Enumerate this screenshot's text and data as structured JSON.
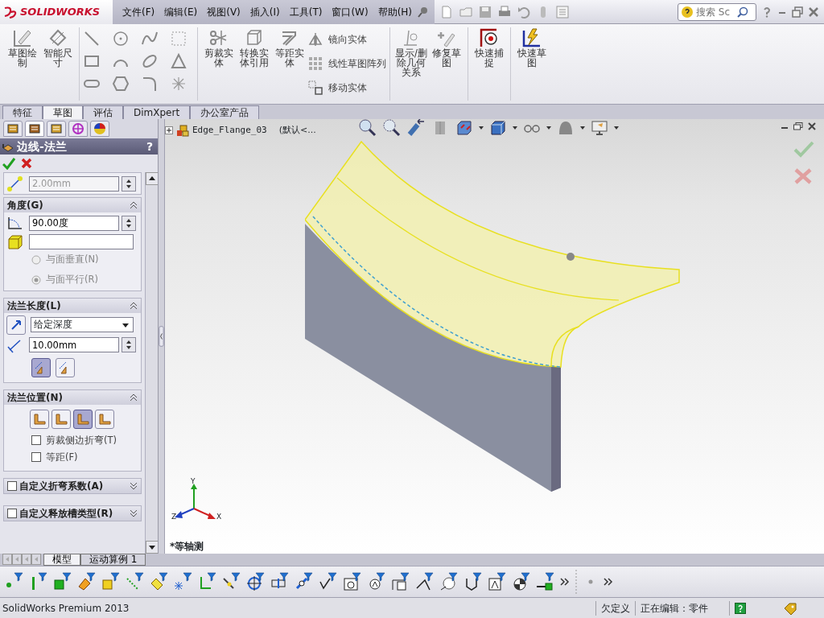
{
  "app": {
    "logo": "SOLIDWORKS"
  },
  "menu": [
    "文件(F)",
    "编辑(E)",
    "视图(V)",
    "插入(I)",
    "工具(T)",
    "窗口(W)",
    "帮助(H)"
  ],
  "search": {
    "placeholder": "搜索 Sc"
  },
  "ribbon": {
    "sketch_buttons": [
      "草图绘制",
      "智能尺寸"
    ],
    "edit_buttons": [
      "剪裁实体",
      "转换实体引用",
      "等距实体"
    ],
    "small_buttons": [
      "镜向实体",
      "线性草图阵列",
      "移动实体"
    ],
    "relation_buttons": [
      "显示/删除几何关系",
      "修复草图"
    ],
    "snap_button": "快速捕捉",
    "quick_button": "快速草图"
  },
  "tabs": [
    {
      "label": "特征",
      "selected": false
    },
    {
      "label": "草图",
      "selected": true
    },
    {
      "label": "评估",
      "selected": false
    },
    {
      "label": "DimXpert",
      "selected": false
    },
    {
      "label": "办公室产品",
      "selected": false
    }
  ],
  "property_manager": {
    "title": "边线-法兰",
    "help": "?",
    "gap_value": "2.00mm",
    "angle": {
      "title": "角度(G)",
      "value": "90.00度",
      "radios": [
        {
          "label": "与面垂直(N)",
          "selected": false
        },
        {
          "label": "与面平行(R)",
          "selected": true
        }
      ]
    },
    "length": {
      "title": "法兰长度(L)",
      "mode": "给定深度",
      "value": "10.00mm",
      "toggles": [
        {
          "selected": true
        },
        {
          "selected": false
        }
      ]
    },
    "position": {
      "title": "法兰位置(N)",
      "options": [
        {
          "selected": false
        },
        {
          "selected": false
        },
        {
          "selected": true
        },
        {
          "selected": false
        }
      ],
      "checks": [
        {
          "label": "剪裁侧边折弯(T)",
          "checked": false
        },
        {
          "label": "等距(F)",
          "checked": false
        }
      ]
    },
    "collapsed": [
      {
        "label": "自定义折弯系数(A)",
        "checked": false
      },
      {
        "label": "自定义释放槽类型(R)",
        "checked": false
      }
    ]
  },
  "viewport": {
    "tree_item": "Edge_Flange_03",
    "tree_config": "(默认<...",
    "view_label": "*等轴测",
    "triad": [
      "Y",
      "Z",
      "X"
    ]
  },
  "bottom_tabs": [
    {
      "label": "模型",
      "selected": true
    },
    {
      "label": "运动算例 1",
      "selected": false
    }
  ],
  "status": {
    "product": "SolidWorks Premium 2013",
    "state": "欠定义",
    "editing": "正在编辑：零件"
  }
}
